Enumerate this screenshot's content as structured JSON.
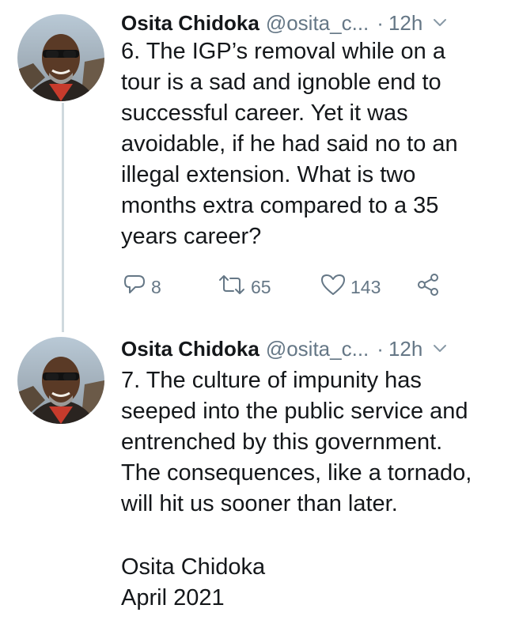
{
  "thread": {
    "tweets": [
      {
        "display_name": "Osita Chidoka",
        "handle": "@osita_c...",
        "separator": "·",
        "time": "12h",
        "text": "6. The IGP’s removal while on a\ntour is a sad and ignoble end to\nsuccessful career. Yet it was\navoidable, if he had said no to an\nillegal extension. What is two\nmonths extra compared to a 35\nyears career?",
        "replies": "8",
        "retweets": "65",
        "likes": "143"
      },
      {
        "display_name": "Osita Chidoka",
        "handle": "@osita_c...",
        "separator": "·",
        "time": "12h",
        "text": "7. The culture of impunity has\nseeped into the public service and\nentrenched by this government.\nThe consequences, like a tornado,\nwill hit us sooner than later.",
        "signature_name": "Osita Chidoka",
        "signature_date": "April 2021"
      }
    ]
  },
  "icons": {
    "reply": "reply-icon",
    "retweet": "retweet-icon",
    "like": "heart-icon",
    "share": "share-icon",
    "menu": "chevron-down-icon"
  },
  "colors": {
    "text": "#14171a",
    "secondary": "#657786",
    "thread_line": "#cfd9de"
  }
}
